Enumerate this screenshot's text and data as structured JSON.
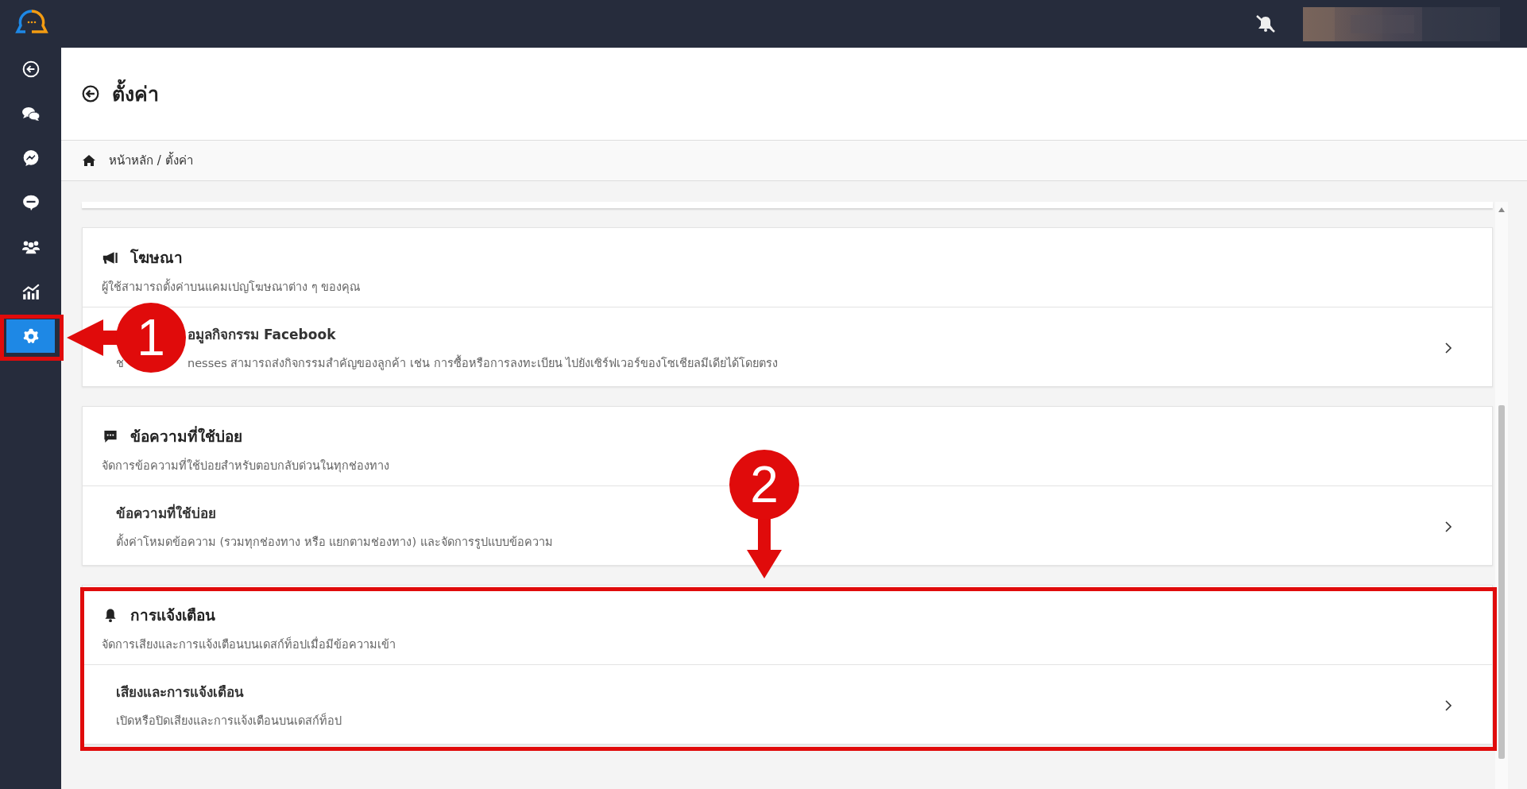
{
  "sidebar": {
    "items": [
      {
        "selected": false
      },
      {
        "selected": false
      },
      {
        "selected": false
      },
      {
        "selected": false
      },
      {
        "selected": false
      },
      {
        "selected": false
      },
      {
        "selected": true
      }
    ]
  },
  "header": {
    "title": "ตั้งค่า"
  },
  "breadcrumb": [
    "หน้าหลัก / ตั้งค่า"
  ],
  "cards": [
    {
      "title": "โฆษณา",
      "description": "ผู้ใช้สามารถตั้งค่าบนแคมเปญโฆษณาต่าง ๆ ของคุณ",
      "rows": [
        {
          "title": "อมูลกิจกรรม Facebook",
          "description_parts": [
            "ช",
            "nesses สามารถส่งกิจกรรมสำคัญของลูกค้า เช่น การซื้อหรือการลงทะเบียน ไปยังเซิร์ฟเวอร์ของโซเชียลมีเดียได้โดยตรง"
          ],
          "partly_covered": true
        }
      ]
    },
    {
      "title": "ข้อความที่ใช้บ่อย",
      "description": "จัดการข้อความที่ใช้บ่อยสำหรับตอบกลับด่วนในทุกช่องทาง",
      "rows": [
        {
          "title": "ข้อความที่ใช้บ่อย",
          "description_parts": [
            "ตั้งค่าโหมดข้อความ (รวมทุกช่องทาง หรือ แยกตามช่องทาง) และจัดการรูปแบบข้อความ"
          ]
        }
      ]
    },
    {
      "title": "การแจ้งเตือน",
      "description": "จัดการเสียงและการแจ้งเตือนบนเดสก์ท็อปเมื่อมีข้อความเข้า",
      "rows": [
        {
          "title": "เสียงและการแจ้งเตือน",
          "description_parts": [
            "เปิดหรือปิดเสียงและการแจ้งเตือนบนเดสก์ท็อป"
          ]
        }
      ]
    }
  ],
  "annotations": [
    {
      "label": "1"
    },
    {
      "label": "2"
    }
  ]
}
